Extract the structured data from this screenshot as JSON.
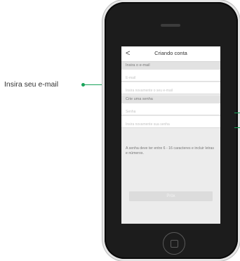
{
  "nav": {
    "title": "Criando conta",
    "back_glyph": "<"
  },
  "email_section": {
    "label": "Insira o e-mail",
    "email_placeholder": "E-mail",
    "email_confirm_placeholder": "Insira novamente o seu e-mail"
  },
  "password_section": {
    "label": "Crie uma senha",
    "password_placeholder": "Senha",
    "password_confirm_placeholder": "Insira novamente sua senha"
  },
  "info_text": "A senha deve ter entre 6 - 16 caracteres e incluir letras e números.",
  "primary_button_label": "Pròx",
  "annotation": {
    "label": "Insira seu e-mail",
    "color": "#19a35a"
  },
  "icons": {
    "back": "chevron-left-icon",
    "home": "home-button-icon"
  }
}
